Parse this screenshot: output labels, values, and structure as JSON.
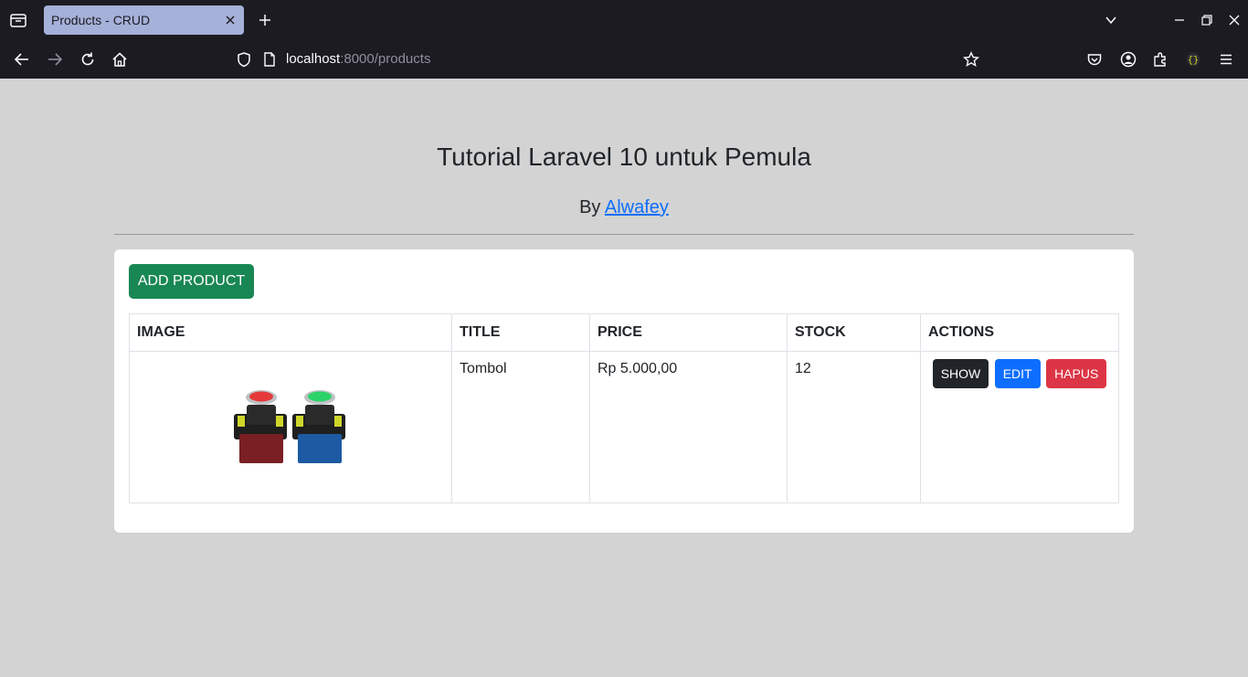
{
  "browser": {
    "tab_title": "Products - CRUD",
    "url_host": "localhost",
    "url_rest": ":8000/products"
  },
  "header": {
    "title": "Tutorial Laravel 10 untuk Pemula",
    "by_label": "By",
    "author": "Alwafey"
  },
  "toolbar": {
    "add_label": "ADD PRODUCT"
  },
  "table": {
    "columns": [
      "IMAGE",
      "TITLE",
      "PRICE",
      "STOCK",
      "ACTIONS"
    ],
    "rows": [
      {
        "title": "Tombol",
        "price": "Rp 5.000,00",
        "stock": "12"
      }
    ],
    "actions": {
      "show": "SHOW",
      "edit": "EDIT",
      "delete": "HAPUS"
    }
  },
  "icons": {
    "back": "arrow-left-icon",
    "forward": "arrow-right-icon",
    "reload": "reload-icon",
    "home": "home-icon",
    "shield": "shield-icon",
    "page": "page-icon",
    "bookmark": "star-icon",
    "pocket": "pocket-icon",
    "account": "account-icon",
    "extensions": "extensions-icon",
    "menu": "hamburger-icon"
  },
  "colors": {
    "chrome_bg": "#1c1b22",
    "tab_active": "#a6b1d9",
    "page_bg": "#d3d3d3",
    "success": "#198754",
    "primary": "#0d6efd",
    "danger": "#dc3545",
    "dark": "#212529"
  }
}
